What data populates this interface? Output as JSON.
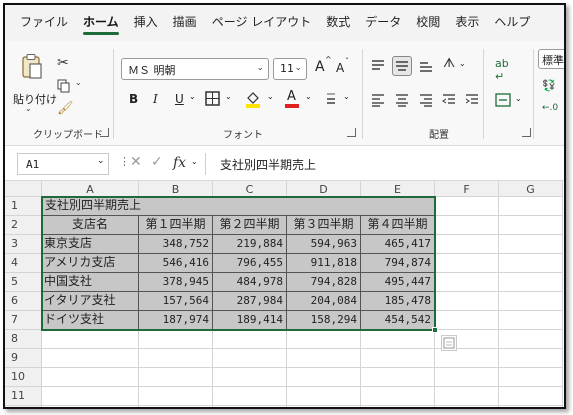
{
  "menu": {
    "tabs": [
      "ファイル",
      "ホーム",
      "挿入",
      "描画",
      "ページ レイアウト",
      "数式",
      "データ",
      "校閲",
      "表示",
      "ヘルプ"
    ],
    "active_tab": "ホーム"
  },
  "ribbon": {
    "clipboard": {
      "paste_label": "貼り付け",
      "group_label": "クリップボード"
    },
    "font": {
      "font_name": "ＭＳ 明朝",
      "font_size": "11",
      "grow_label": "A",
      "shrink_label": "A",
      "bold_label": "B",
      "italic_label": "I",
      "underline_label": "U",
      "font_color_label": "A",
      "group_label": "フォント",
      "underline_color": "#e02020",
      "highlight_color": "#ffe400"
    },
    "alignment": {
      "group_label": "配置"
    },
    "number": {
      "format_label": "標準"
    }
  },
  "formula_bar": {
    "name_box": "A1",
    "fx_label": "fx",
    "formula": "支社別四半期売上"
  },
  "sheet": {
    "columns": [
      "A",
      "B",
      "C",
      "D",
      "E",
      "F",
      "G"
    ],
    "rows": [
      "1",
      "2",
      "3",
      "4",
      "5",
      "6",
      "7",
      "8",
      "9",
      "10",
      "11",
      "12"
    ],
    "title": "支社別四半期売上",
    "headers": [
      "支店名",
      "第１四半期",
      "第２四半期",
      "第３四半期",
      "第４四半期"
    ],
    "data": [
      [
        "東京支店",
        "348,752",
        "219,884",
        "594,963",
        "465,417"
      ],
      [
        "アメリカ支店",
        "546,416",
        "796,455",
        "911,818",
        "794,874"
      ],
      [
        "中国支社",
        "378,945",
        "484,978",
        "794,828",
        "495,447"
      ],
      [
        "イタリア支社",
        "157,564",
        "287,984",
        "204,084",
        "185,478"
      ],
      [
        "ドイツ支社",
        "187,974",
        "189,414",
        "158,294",
        "454,542"
      ]
    ]
  },
  "colors": {
    "accent": "#1e6b3a",
    "selected_fill": "#c7c7c7"
  }
}
